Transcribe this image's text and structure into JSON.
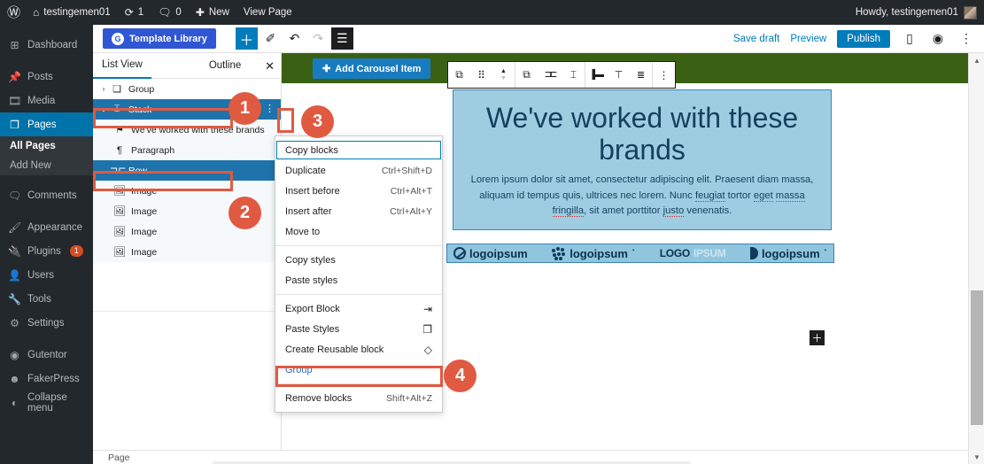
{
  "adminbar": {
    "logo_icon": "wordpress-icon",
    "home_icon": "home-icon",
    "site_name": "testingemen01",
    "updates_icon": "updates-icon",
    "updates_count": "1",
    "comments_icon": "comment-icon",
    "comments_count": "0",
    "new_icon": "plus-icon",
    "new_label": "New",
    "view_page_label": "View Page",
    "howdy": "Howdy, testingemen01"
  },
  "adminmenu": {
    "items": [
      {
        "label": "Dashboard",
        "icon": "dashboard-icon"
      },
      {
        "label": "Posts",
        "icon": "pin-icon"
      },
      {
        "label": "Media",
        "icon": "media-icon"
      },
      {
        "label": "Pages",
        "icon": "page-icon",
        "active": true
      },
      {
        "label": "Comments",
        "icon": "comment-icon"
      },
      {
        "label": "Appearance",
        "icon": "brush-icon"
      },
      {
        "label": "Plugins",
        "icon": "plug-icon",
        "badge": "1"
      },
      {
        "label": "Users",
        "icon": "user-icon"
      },
      {
        "label": "Tools",
        "icon": "wrench-icon"
      },
      {
        "label": "Settings",
        "icon": "settings-icon"
      },
      {
        "label": "Gutentor",
        "icon": "gutentor-icon"
      },
      {
        "label": "FakerPress",
        "icon": "fakerpress-icon"
      },
      {
        "label": "Collapse menu",
        "icon": "collapse-icon"
      }
    ],
    "submenu": [
      {
        "label": "All Pages",
        "current": true
      },
      {
        "label": "Add New",
        "current": false
      }
    ]
  },
  "editor_header": {
    "template_library_label": "Template Library",
    "template_library_icon": "gutentor-icon",
    "tools": [
      {
        "name": "add-block-icon",
        "glyph": "+"
      },
      {
        "name": "edit-tool-icon",
        "glyph": "✎"
      },
      {
        "name": "undo-icon",
        "glyph": "↶"
      },
      {
        "name": "redo-icon",
        "glyph": "↷"
      },
      {
        "name": "list-view-icon",
        "glyph": "☰"
      }
    ],
    "save_draft_label": "Save draft",
    "preview_label": "Preview",
    "publish_label": "Publish",
    "sidebar_toggle_icon": "settings-panel-icon",
    "gutentor_icon": "gutentor-icon",
    "options_icon": "ellipsis-vertical-icon"
  },
  "listview": {
    "tab_list_view": "List View",
    "tab_outline": "Outline",
    "close_icon": "close-icon",
    "rows": [
      {
        "label": "Group",
        "icon": "group-icon",
        "chevron": "›",
        "indent": 0,
        "selected": false
      },
      {
        "label": "Stack",
        "icon": "stack-icon",
        "chevron": "⌄",
        "indent": 0,
        "selected": true,
        "has_more": true,
        "more_icon": "ellipsis-vertical-icon"
      },
      {
        "label": "We've worked with these brands",
        "icon": "heading-icon",
        "chevron": "",
        "indent": 1,
        "selected": false
      },
      {
        "label": "Paragraph",
        "icon": "paragraph-icon",
        "chevron": "",
        "indent": 1,
        "selected": false
      },
      {
        "label": "Row",
        "icon": "row-icon",
        "chevron": "⌄",
        "indent": 0,
        "selected": true
      },
      {
        "label": "Image",
        "icon": "image-icon",
        "chevron": "",
        "indent": 1,
        "selected": false
      },
      {
        "label": "Image",
        "icon": "image-icon",
        "chevron": "",
        "indent": 1,
        "selected": false
      },
      {
        "label": "Image",
        "icon": "image-icon",
        "chevron": "",
        "indent": 1,
        "selected": false
      },
      {
        "label": "Image",
        "icon": "image-icon",
        "chevron": "",
        "indent": 1,
        "selected": false
      }
    ]
  },
  "context_menu": {
    "items": [
      {
        "label": "Copy blocks",
        "shortcut": "",
        "focused": true,
        "icon": ""
      },
      {
        "label": "Duplicate",
        "shortcut": "Ctrl+Shift+D",
        "focused": false,
        "icon": ""
      },
      {
        "label": "Insert before",
        "shortcut": "Ctrl+Alt+T",
        "focused": false,
        "icon": ""
      },
      {
        "label": "Insert after",
        "shortcut": "Ctrl+Alt+Y",
        "focused": false,
        "icon": ""
      },
      {
        "label": "Move to",
        "shortcut": "",
        "focused": false,
        "icon": ""
      },
      {
        "divider": true
      },
      {
        "label": "Copy styles",
        "shortcut": "",
        "focused": false,
        "icon": ""
      },
      {
        "label": "Paste styles",
        "shortcut": "",
        "focused": false,
        "icon": ""
      },
      {
        "divider": true
      },
      {
        "label": "Export Block",
        "shortcut": "",
        "focused": false,
        "icon": "export-icon",
        "glyph": "⇥"
      },
      {
        "label": "Paste Styles",
        "shortcut": "",
        "focused": false,
        "icon": "clipboard-icon",
        "glyph": "❐"
      },
      {
        "label": "Create Reusable block",
        "shortcut": "",
        "focused": false,
        "icon": "reusable-icon",
        "glyph": "◇"
      },
      {
        "label": "Group",
        "shortcut": "",
        "focused": false,
        "icon": "",
        "link": true,
        "highlighted": true
      },
      {
        "divider": true
      },
      {
        "label": "Remove blocks",
        "shortcut": "Shift+Alt+Z",
        "focused": false,
        "icon": ""
      }
    ]
  },
  "canvas": {
    "add_carousel_label": "Add Carousel Item",
    "add_carousel_icon": "plus-icon",
    "block_toolbar": [
      {
        "name": "select-parent-icon",
        "glyph": "⧉"
      },
      {
        "name": "drag-handle-icon",
        "glyph": "⠿"
      },
      {
        "name": "move-updown-icon",
        "glyph": "⌃"
      },
      {
        "name": "block-type-icon",
        "glyph": "⧉"
      },
      {
        "name": "row-icon",
        "glyph": "⊐⊏"
      },
      {
        "name": "stack-icon",
        "glyph": "⌶"
      },
      {
        "name": "justify-left-icon",
        "glyph": "⊢"
      },
      {
        "name": "align-top-icon",
        "glyph": "⊤"
      },
      {
        "name": "align-stretch-icon",
        "glyph": "≡"
      },
      {
        "name": "more-options-icon",
        "glyph": "⋮"
      }
    ],
    "hero_heading": "We've worked with these brands",
    "hero_paragraph_1": "Lorem ipsum dolor sit amet, consectetur adipiscing elit. Praesent diam massa, aliquam id tempus quis, ultrices nec lorem. Nunc ",
    "hero_sp_1": "feugiat",
    "hero_paragraph_2": " tortor ",
    "hero_sp_2": "eget",
    "hero_paragraph_3": " ",
    "hero_sp_3": "massa",
    "hero_paragraph_4": " ",
    "hero_sp_4": "fringilla",
    "hero_paragraph_5": ", sit amet porttitor ",
    "hero_sp_5": "justo",
    "hero_paragraph_6": " venenatis.",
    "logos": [
      {
        "text": "logoipsum",
        "mark": "circle-slash-icon"
      },
      {
        "text": "logoipsum",
        "mark": "dots-icon",
        "sup": "˙"
      },
      {
        "text_a": "LOGO",
        "text_b": "IPSUM",
        "mark": "none"
      },
      {
        "text": "logoipsum",
        "mark": "half-circle-icon",
        "sup": "˙"
      }
    ],
    "add_block_tile_icon": "plus-icon"
  },
  "annotations": {
    "markers": [
      {
        "number": "1"
      },
      {
        "number": "2"
      },
      {
        "number": "3"
      },
      {
        "number": "4"
      }
    ],
    "accent_color": "#e05a42"
  },
  "bottombar": {
    "label": "Page"
  },
  "scrollbar": {
    "up_icon": "caret-up-icon",
    "down_icon": "caret-down-icon"
  }
}
